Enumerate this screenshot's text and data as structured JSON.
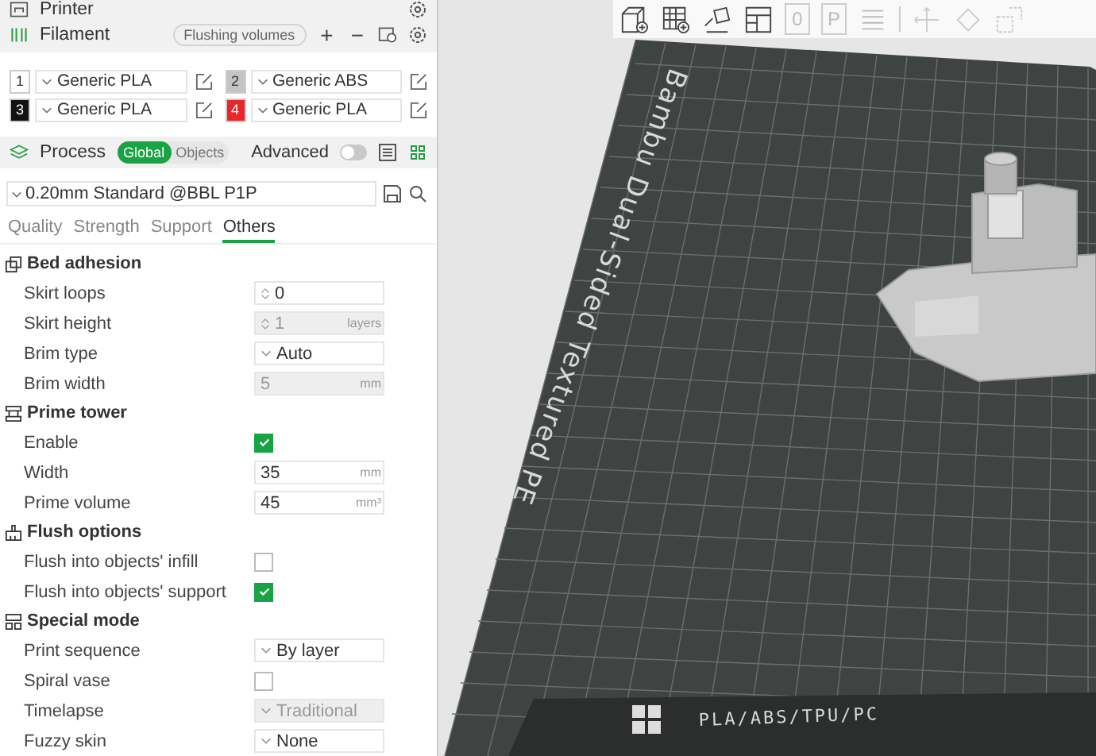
{
  "printer": {
    "title": "Printer"
  },
  "filament": {
    "title": "Filament",
    "flush_button": "Flushing volumes",
    "add": "+",
    "remove": "−",
    "slots": [
      {
        "number": "1",
        "color": "#ffffff",
        "material": "Generic PLA"
      },
      {
        "number": "2",
        "color": "#c4c4c4",
        "material": "Generic ABS"
      },
      {
        "number": "3",
        "color": "#111111",
        "material": "Generic PLA"
      },
      {
        "number": "4",
        "color": "#e8262b",
        "material": "Generic PLA"
      }
    ]
  },
  "process": {
    "title": "Process",
    "scopes": [
      {
        "label": "Global",
        "selected": true
      },
      {
        "label": "Objects",
        "selected": false
      }
    ],
    "advanced": {
      "label": "Advanced",
      "on": false
    },
    "preset": "0.20mm Standard @BBL P1P",
    "tabs": [
      {
        "label": "Quality",
        "selected": false
      },
      {
        "label": "Strength",
        "selected": false
      },
      {
        "label": "Support",
        "selected": false
      },
      {
        "label": "Others",
        "selected": true
      }
    ],
    "sections": [
      {
        "title": "Bed adhesion",
        "rows": [
          {
            "label": "Skirt loops",
            "kind": "spin",
            "value": "0",
            "disabled": false
          },
          {
            "label": "Skirt height",
            "kind": "spin",
            "value": "1",
            "unit": "layers",
            "disabled": true
          },
          {
            "label": "Brim type",
            "kind": "dropdown",
            "value": "Auto",
            "disabled": false
          },
          {
            "label": "Brim width",
            "kind": "number",
            "value": "5",
            "unit": "mm",
            "disabled": true
          }
        ]
      },
      {
        "title": "Prime tower",
        "rows": [
          {
            "label": "Enable",
            "kind": "checkbox",
            "checked": true
          },
          {
            "label": "Width",
            "kind": "number",
            "value": "35",
            "unit": "mm",
            "disabled": false
          },
          {
            "label": "Prime volume",
            "kind": "number",
            "value": "45",
            "unit": "mm³",
            "disabled": false
          }
        ]
      },
      {
        "title": "Flush options",
        "rows": [
          {
            "label": "Flush into objects' infill",
            "kind": "checkbox",
            "checked": false
          },
          {
            "label": "Flush into objects' support",
            "kind": "checkbox",
            "checked": true
          }
        ]
      },
      {
        "title": "Special mode",
        "rows": [
          {
            "label": "Print sequence",
            "kind": "dropdown",
            "value": "By layer",
            "disabled": false
          },
          {
            "label": "Spiral vase",
            "kind": "checkbox",
            "checked": false
          },
          {
            "label": "Timelapse",
            "kind": "dropdown",
            "value": "Traditional",
            "disabled": true
          },
          {
            "label": "Fuzzy skin",
            "kind": "dropdown",
            "value": "None",
            "disabled": false
          }
        ]
      }
    ]
  },
  "viewport": {
    "toolbar_glyphs": [
      "0",
      "P"
    ],
    "plate_name": "Bambu Dual-Sided Textured PE",
    "plate_materials": "PLA/ABS/TPU/PC"
  }
}
